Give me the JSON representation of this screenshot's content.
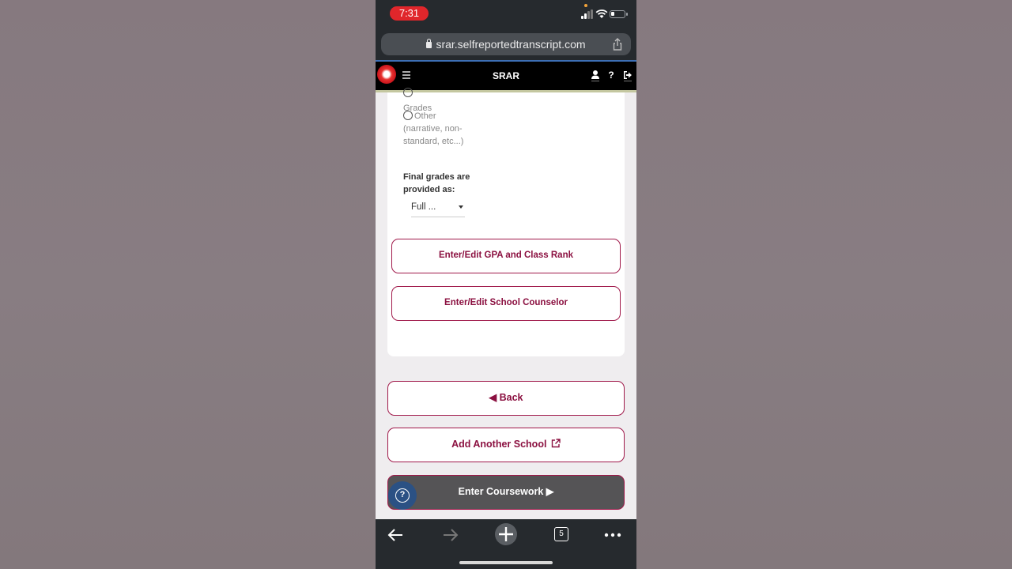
{
  "status_bar": {
    "time": "7:31"
  },
  "browser": {
    "url": "srar.selfreportedtranscript.com",
    "tab_count": "5"
  },
  "app_header": {
    "title": "SRAR"
  },
  "form": {
    "radio_partial_label": "Grades",
    "radio_other_label": "Other",
    "radio_other_desc": "(narrative, non-standard, etc...)",
    "final_grades_label": "Final grades are provided as:",
    "final_grades_value": "Full ..."
  },
  "buttons": {
    "gpa_rank": "Enter/Edit GPA and Class Rank",
    "counselor": "Enter/Edit School Counselor",
    "back": "◀ Back",
    "add_school": "Add Another School",
    "enter_coursework": "Enter Coursework ▶"
  },
  "colors": {
    "accent": "#a0194a",
    "header_bg": "#000000",
    "help_fab": "#2b5184"
  }
}
